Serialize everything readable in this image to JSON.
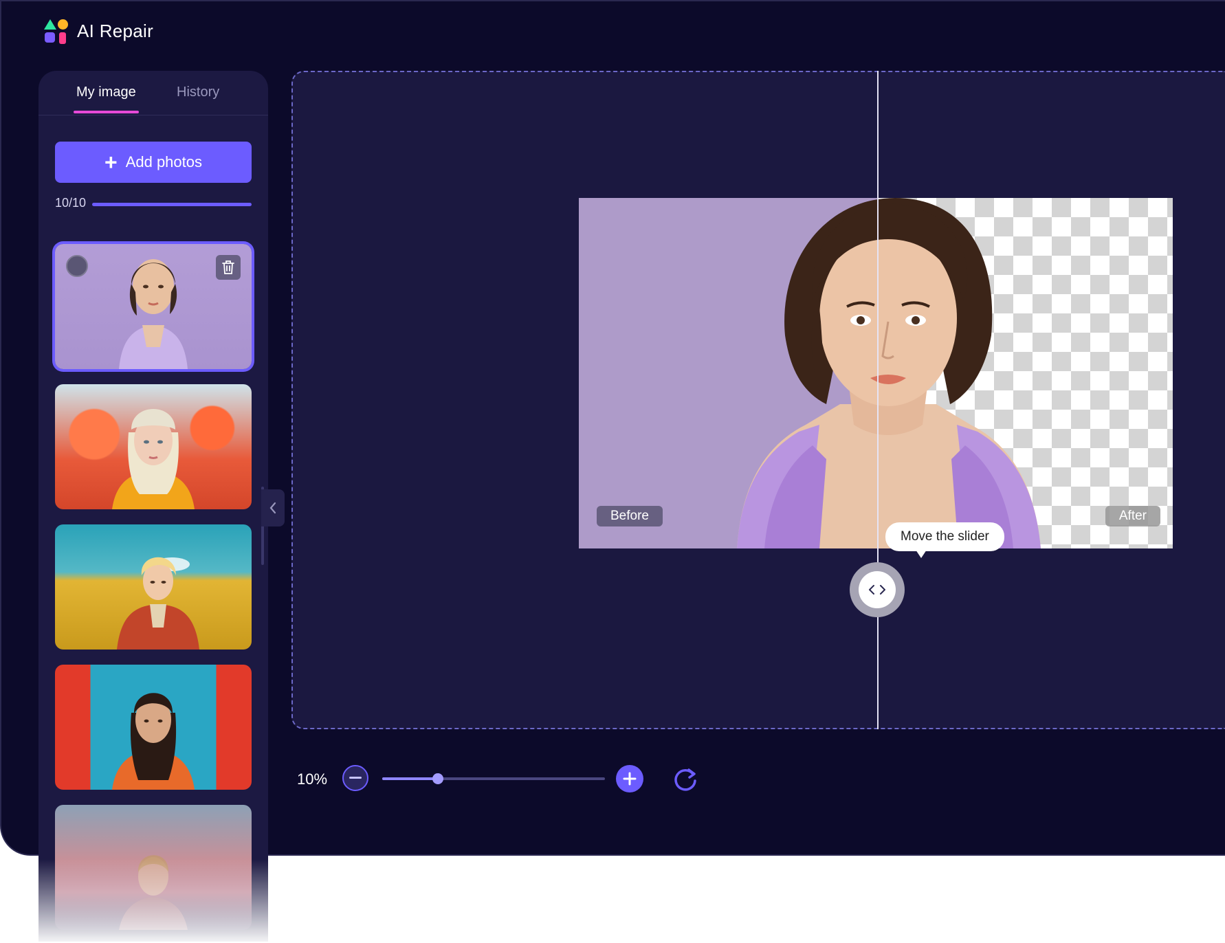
{
  "app": {
    "title": "AI Repair",
    "colors": {
      "background": "#0c0a2a",
      "panel": "#1c1942",
      "accent": "#6c5cff",
      "tab_underline": "#e64ad8"
    }
  },
  "sidebar": {
    "tabs": [
      {
        "label": "My image",
        "active": true
      },
      {
        "label": "History",
        "active": false
      }
    ],
    "add_button_label": "Add photos",
    "add_button_icon": "plus-icon",
    "count_text": "10/10",
    "count_progress": 1.0,
    "thumbnails": [
      {
        "name": "thumbnail-woman-purple-vest",
        "selected": true
      },
      {
        "name": "thumbnail-woman-mushrooms",
        "selected": false
      },
      {
        "name": "thumbnail-man-yellow-field",
        "selected": false
      },
      {
        "name": "thumbnail-woman-red-blue-structure",
        "selected": false
      },
      {
        "name": "thumbnail-woman-pink-rocks",
        "selected": false
      }
    ],
    "collapse_icon": "chevron-left-icon"
  },
  "preview": {
    "before_label": "Before",
    "after_label": "After",
    "tooltip": "Move the slider",
    "slider_icon": "arrows-left-right-icon"
  },
  "toolbar": {
    "zoom_text": "10%",
    "zoom_value": 0.25,
    "zoom_out_icon": "minus-icon",
    "zoom_in_icon": "plus-icon",
    "reset_icon": "rotate-icon"
  }
}
